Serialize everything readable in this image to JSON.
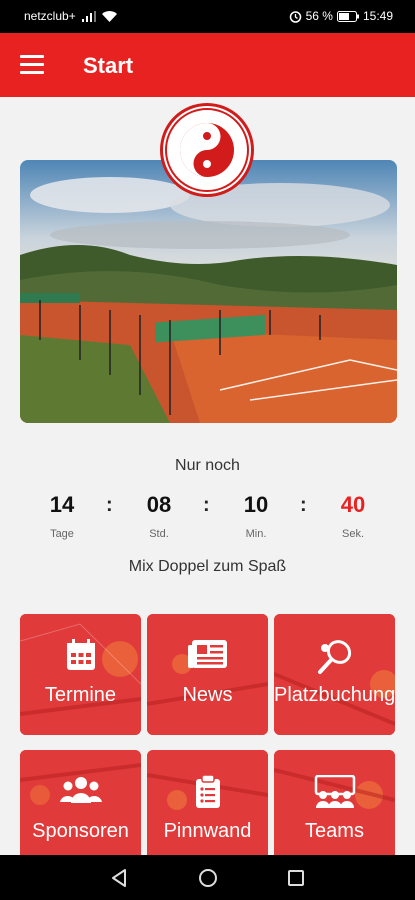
{
  "status_bar": {
    "carrier": "netzclub+",
    "battery": "56 %",
    "time": "15:49"
  },
  "header": {
    "title": "Start"
  },
  "countdown": {
    "label": "Nur noch",
    "days": "14",
    "days_unit": "Tage",
    "hours": "08",
    "hours_unit": "Std.",
    "minutes": "10",
    "minutes_unit": "Min.",
    "seconds": "40",
    "seconds_unit": "Sek.",
    "separator": ":",
    "event": "Mix Doppel zum Spaß"
  },
  "tiles": [
    {
      "label": "Termine",
      "icon": "calendar-icon"
    },
    {
      "label": "News",
      "icon": "newspaper-icon"
    },
    {
      "label": "Platzbuchung",
      "icon": "tennis-racket-icon"
    },
    {
      "label": "Sponsoren",
      "icon": "group-icon"
    },
    {
      "label": "Pinnwand",
      "icon": "clipboard-icon"
    },
    {
      "label": "Teams",
      "icon": "team-board-icon"
    }
  ],
  "colors": {
    "primary": "#e82121",
    "seconds": "#e82121",
    "tile": "#e03a3a"
  }
}
